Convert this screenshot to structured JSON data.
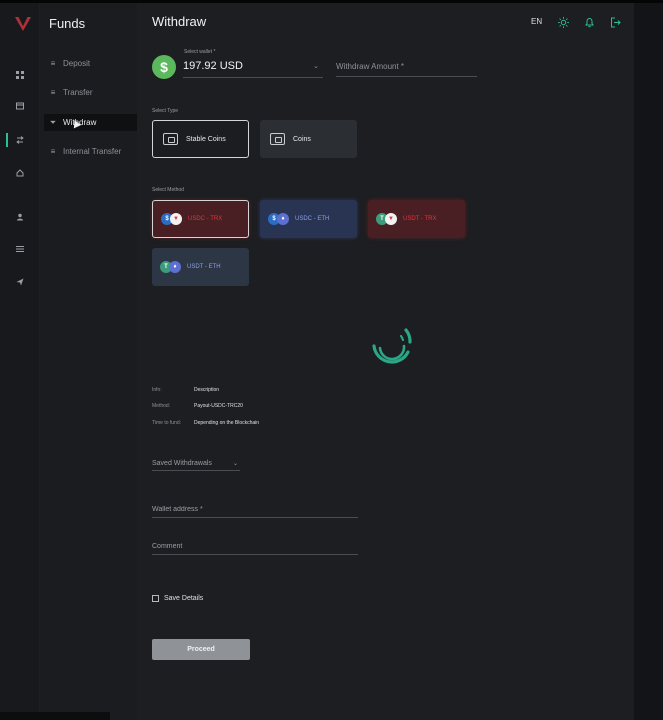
{
  "header": {
    "title": "Withdraw",
    "language": "EN",
    "icons": [
      "sun-icon",
      "bell-icon",
      "logout-icon"
    ]
  },
  "colors": {
    "accent": "#2fbf8f",
    "red": "#e0333c",
    "blue": "#8aa0e8"
  },
  "rail": {
    "icons": [
      "grid-icon",
      "wallet-icon",
      "transfer-icon",
      "home-icon",
      "user-icon",
      "list-icon",
      "send-icon"
    ]
  },
  "subnav": {
    "title": "Funds",
    "items": [
      {
        "label": "Deposit",
        "icon": "deposit-icon"
      },
      {
        "label": "Transfer",
        "icon": "transfer-icon"
      },
      {
        "label": "Withdraw",
        "icon": "withdraw-icon",
        "active": true
      },
      {
        "label": "Internal Transfer",
        "icon": "internal-transfer-icon"
      }
    ]
  },
  "wallet": {
    "label": "Select wallet *",
    "value": "197.92 USD",
    "currency_icon": "$"
  },
  "amount": {
    "placeholder": "Withdraw Amount *"
  },
  "select_type": {
    "label": "Select Type",
    "options": [
      {
        "label": "Stable Coins",
        "selected": true
      },
      {
        "label": "Coins"
      }
    ]
  },
  "select_method": {
    "label": "Select Method",
    "options": [
      {
        "label": "USDC - TRX",
        "selected": true
      },
      {
        "label": "USDC - ETH"
      },
      {
        "label": "USDT - TRX"
      },
      {
        "label": "USDT - ETH"
      }
    ]
  },
  "info": {
    "rows": [
      {
        "key": "Info:",
        "value": "Description"
      },
      {
        "key": "Method:",
        "value": "Payout-USDC-TRC20"
      },
      {
        "key": "Time to fund:",
        "value": "Depending on the Blockchain"
      }
    ]
  },
  "saved_withdrawals": {
    "label": "Saved Withdrawals"
  },
  "wallet_address": {
    "placeholder": "Wallet address *"
  },
  "comment": {
    "placeholder": "Comment"
  },
  "save_details": {
    "label": "Save Details",
    "checked": false
  },
  "proceed": {
    "label": "Proceed"
  }
}
